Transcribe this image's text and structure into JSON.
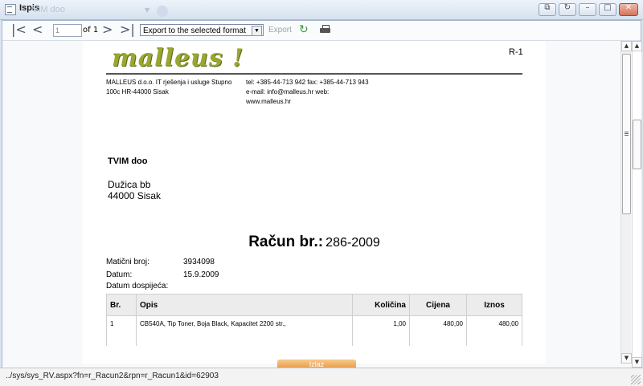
{
  "window": {
    "title": "Ispis",
    "ghost_text": "VIM doo",
    "controls": {
      "restore_icon": "restore-icon",
      "refresh_icon": "refresh-icon",
      "minimize_icon": "minimize-icon",
      "maximize_icon": "maximize-icon",
      "close_icon": "close-icon"
    }
  },
  "toolbar": {
    "page_value": "1",
    "page_of": "of 1",
    "export_format": "Export to the selected format",
    "export_label": "Export"
  },
  "report": {
    "logo": "malleus !",
    "doc_code": "R-1",
    "company_lines": [
      "MALLEUS d.o.o. IT rješenja i usluge Stupno",
      "100c HR-44000 Sisak"
    ],
    "contact_lines": [
      "tel: +385-44-713 942 fax: +385-44-713 943",
      "e-mail: info@malleus.hr web:",
      "www.malleus.hr"
    ],
    "customer": {
      "name": "TVIM doo",
      "street": "Dužica bb",
      "city": "44000 Sisak"
    },
    "invoice": {
      "label": "Račun br.:",
      "number": "286-2009"
    },
    "meta": [
      {
        "label": "Matični broj:",
        "value": "3934098"
      },
      {
        "label": "Datum:",
        "value": "15.9.2009"
      },
      {
        "label": "Datum dospijeća:",
        "value": ""
      }
    ],
    "table": {
      "headers": [
        "Br.",
        "Opis",
        "Količina",
        "Cijena",
        "Iznos"
      ],
      "rows": [
        [
          "1",
          "CB540A, Tip Toner, Boja Black, Kapacitet 2200 str.,",
          "1,00",
          "480,00",
          "480,00"
        ]
      ]
    }
  },
  "bottom_button": "Izlaz",
  "status": {
    "url": "../sys/sys_RV.aspx?fn=r_Racun2&rpn=r_Racun1&id=62903"
  }
}
